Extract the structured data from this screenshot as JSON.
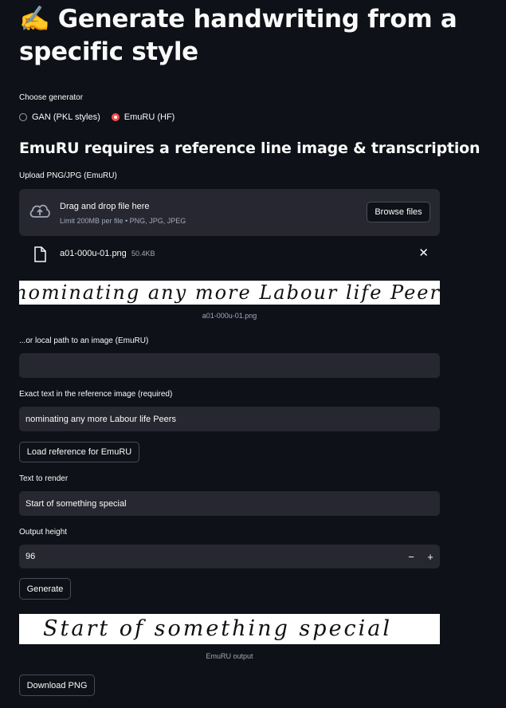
{
  "page": {
    "title": "✍️ Generate handwriting from a specific style"
  },
  "generator": {
    "label": "Choose generator",
    "options": [
      "GAN (PKL styles)",
      "EmuRU (HF)"
    ],
    "selected": "EmuRU (HF)"
  },
  "section": {
    "heading": "EmuRU requires a reference line image & transcription"
  },
  "upload": {
    "label": "Upload PNG/JPG (EmuRU)",
    "drop_text": "Drag and drop file here",
    "limit_text": "Limit 200MB per file • PNG, JPG, JPEG",
    "browse_label": "Browse files",
    "file_name": "a01-000u-01.png",
    "file_size": "50.4KB",
    "remove_glyph": "✕"
  },
  "reference_image": {
    "text": "nominating any more Labour life Peers",
    "caption": "a01-000u-01.png"
  },
  "local_path": {
    "label": "...or local path to an image (EmuRU)",
    "value": ""
  },
  "exact_text": {
    "label": "Exact text in the reference image (required)",
    "value": "nominating any more Labour life Peers"
  },
  "load_button": {
    "label": "Load reference for EmuRU"
  },
  "render_text": {
    "label": "Text to render",
    "value": "Start of something special"
  },
  "output_height": {
    "label": "Output height",
    "value": "96",
    "minus": "−",
    "plus": "+"
  },
  "generate_button": {
    "label": "Generate"
  },
  "output_image": {
    "text": "Start of something special",
    "caption": "EmuRU output"
  },
  "download_button": {
    "label": "Download PNG"
  }
}
